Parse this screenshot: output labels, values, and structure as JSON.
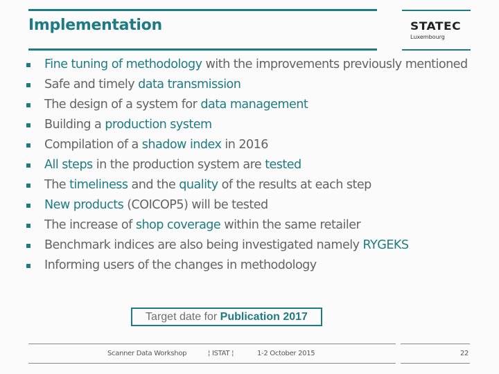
{
  "header": {
    "title": "Implementation",
    "logo": {
      "name": "STATEC",
      "subtitle": "Luxembourg"
    }
  },
  "colors": {
    "accent": "#1e7b83",
    "text": "#636363"
  },
  "bullets": [
    {
      "segments": [
        {
          "text": "Fine tuning of methodology",
          "hl": true
        },
        {
          "text": " with the improvements previously mentioned",
          "hl": false
        }
      ]
    },
    {
      "segments": [
        {
          "text": "Safe and timely ",
          "hl": false
        },
        {
          "text": "data transmission",
          "hl": true
        }
      ]
    },
    {
      "segments": [
        {
          "text": "The design of a system for ",
          "hl": false
        },
        {
          "text": "data management",
          "hl": true
        }
      ]
    },
    {
      "segments": [
        {
          "text": "Building a ",
          "hl": false
        },
        {
          "text": "production system",
          "hl": true
        }
      ]
    },
    {
      "segments": [
        {
          "text": "Compilation of a ",
          "hl": false
        },
        {
          "text": "shadow index",
          "hl": true
        },
        {
          "text": " in 2016",
          "hl": false
        }
      ]
    },
    {
      "segments": [
        {
          "text": "All steps",
          "hl": true
        },
        {
          "text": " in the production system are ",
          "hl": false
        },
        {
          "text": "tested",
          "hl": true
        }
      ]
    },
    {
      "segments": [
        {
          "text": "The ",
          "hl": false
        },
        {
          "text": "timeliness",
          "hl": true
        },
        {
          "text": " and the ",
          "hl": false
        },
        {
          "text": "quality",
          "hl": true
        },
        {
          "text": " of the results at each step",
          "hl": false
        }
      ]
    },
    {
      "segments": [
        {
          "text": "New products",
          "hl": true
        },
        {
          "text": " (COICOP5) will be tested",
          "hl": false
        }
      ]
    },
    {
      "segments": [
        {
          "text": "The increase of ",
          "hl": false
        },
        {
          "text": "shop coverage",
          "hl": true
        },
        {
          "text": " within the same retailer",
          "hl": false
        }
      ]
    },
    {
      "segments": [
        {
          "text": "Benchmark indices are also being investigated namely ",
          "hl": false
        },
        {
          "text": "RYGEKS",
          "hl": true
        }
      ]
    },
    {
      "segments": [
        {
          "text": "Informing users of the changes in methodology",
          "hl": false
        }
      ]
    }
  ],
  "target": {
    "prefix": "Target date for ",
    "emphasis": "Publication 2017"
  },
  "footer": {
    "event": "Scanner Data Workshop",
    "host": "¦ ISTAT ¦",
    "date": "1-2 October 2015",
    "page": "22"
  }
}
